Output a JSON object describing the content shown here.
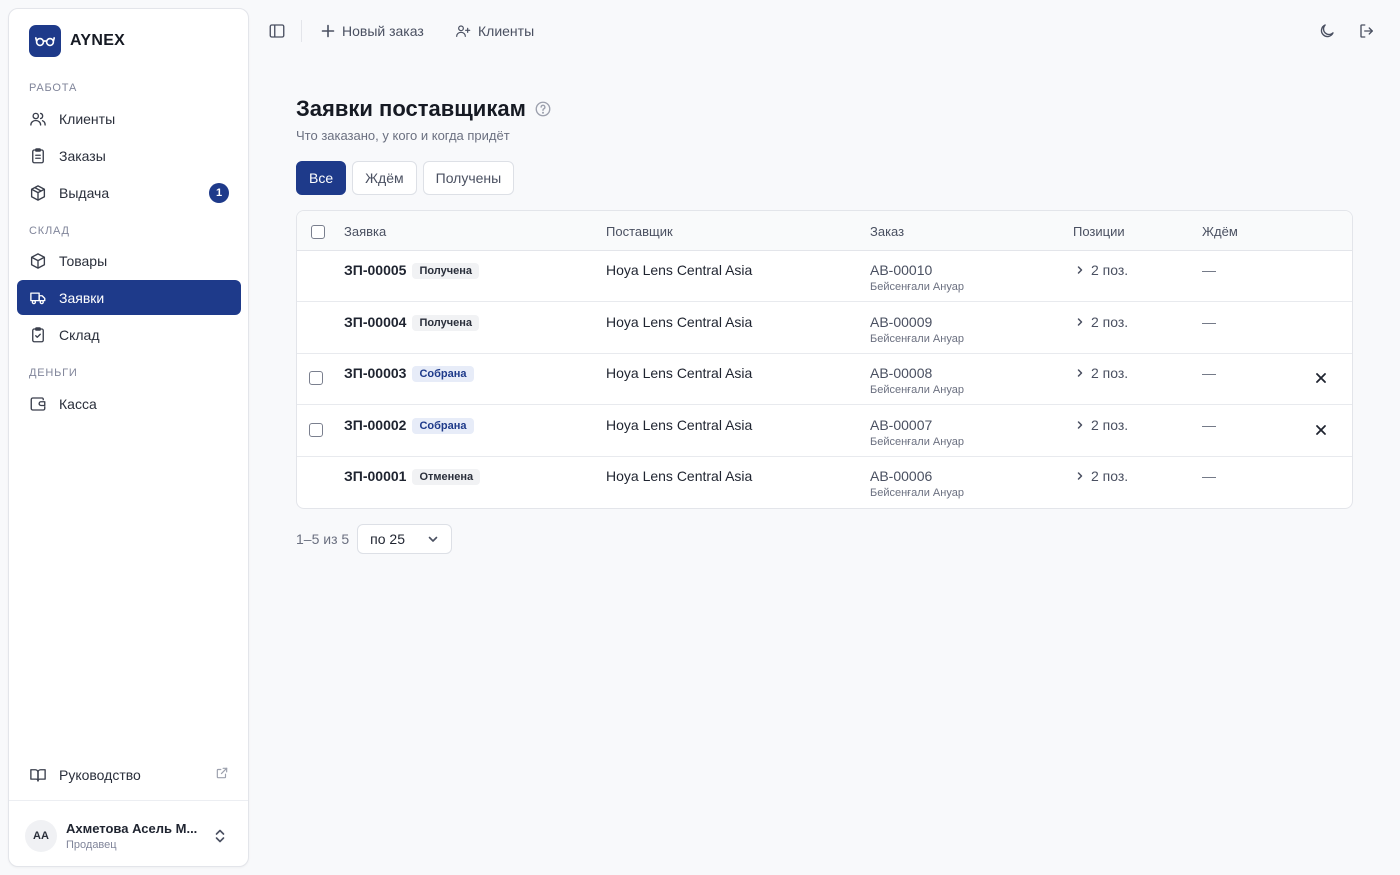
{
  "brand": {
    "name": "AYNEX"
  },
  "sidebar": {
    "sections": {
      "work": "Работа",
      "warehouse": "Склад",
      "money": "Деньги"
    },
    "items": {
      "clients": "Клиенты",
      "orders": "Заказы",
      "issue": "Выдача",
      "issue_badge": "1",
      "goods": "Товары",
      "requests": "Заявки",
      "stock": "Склад",
      "cash": "Касса"
    },
    "guide": "Руководство",
    "user": {
      "initials": "АА",
      "name": "Ахметова Асель М...",
      "role": "Продавец"
    }
  },
  "topbar": {
    "new_order": "Новый заказ",
    "clients": "Клиенты"
  },
  "page": {
    "title": "Заявки поставщикам",
    "subtitle": "Что заказано, у кого и когда придёт"
  },
  "filters": [
    "Все",
    "Ждём",
    "Получены"
  ],
  "table": {
    "headers": [
      "Заявка",
      "Поставщик",
      "Заказ",
      "Позиции",
      "Ждём"
    ],
    "rows": [
      {
        "id": "ЗП-00005",
        "status": "Получена",
        "status_kind": "received",
        "supplier": "Hoya Lens Central Asia",
        "order": "АВ-00010",
        "client": "Бейсенғали Ануар",
        "positions": "2 поз.",
        "wait": "—",
        "selectable": false,
        "removable": false
      },
      {
        "id": "ЗП-00004",
        "status": "Получена",
        "status_kind": "received",
        "supplier": "Hoya Lens Central Asia",
        "order": "АВ-00009",
        "client": "Бейсенғали Ануар",
        "positions": "2 поз.",
        "wait": "—",
        "selectable": false,
        "removable": false
      },
      {
        "id": "ЗП-00003",
        "status": "Собрана",
        "status_kind": "collected",
        "supplier": "Hoya Lens Central Asia",
        "order": "АВ-00008",
        "client": "Бейсенғали Ануар",
        "positions": "2 поз.",
        "wait": "—",
        "selectable": true,
        "removable": true
      },
      {
        "id": "ЗП-00002",
        "status": "Собрана",
        "status_kind": "collected",
        "supplier": "Hoya Lens Central Asia",
        "order": "АВ-00007",
        "client": "Бейсенғали Ануар",
        "positions": "2 поз.",
        "wait": "—",
        "selectable": true,
        "removable": true
      },
      {
        "id": "ЗП-00001",
        "status": "Отменена",
        "status_kind": "cancelled",
        "supplier": "Hoya Lens Central Asia",
        "order": "АВ-00006",
        "client": "Бейсенғали Ануар",
        "positions": "2 поз.",
        "wait": "—",
        "selectable": false,
        "removable": false
      }
    ]
  },
  "pagination": {
    "info": "1–5 из 5",
    "page_size": "по 25"
  },
  "colors": {
    "accent": "#1e3a8a",
    "background": "#f8f9fb"
  }
}
